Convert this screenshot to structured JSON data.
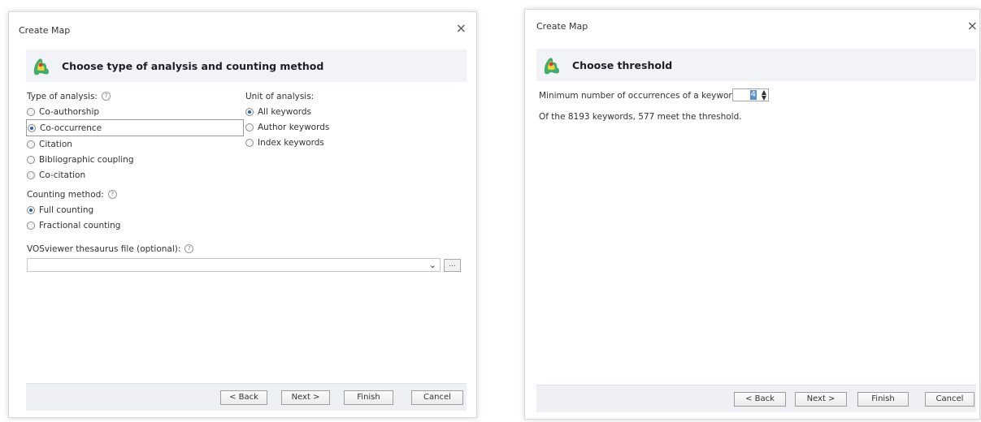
{
  "dialog1": {
    "window_title": "Create Map",
    "close_glyph": "×",
    "header_title": "Choose type of analysis and counting method",
    "type_of_analysis": {
      "label": "Type of analysis:",
      "options": [
        "Co-authorship",
        "Co-occurrence",
        "Citation",
        "Bibliographic coupling",
        "Co-citation"
      ],
      "selected": "Co-occurrence"
    },
    "unit_of_analysis": {
      "label": "Unit of analysis:",
      "options": [
        "All keywords",
        "Author keywords",
        "Index keywords"
      ],
      "selected": "All keywords"
    },
    "counting_method": {
      "label": "Counting method:",
      "options": [
        "Full counting",
        "Fractional counting"
      ],
      "selected": "Full counting"
    },
    "thesaurus": {
      "label": "VOSviewer thesaurus file (optional):",
      "value": "",
      "browse_label": "..."
    },
    "buttons": {
      "back": "< Back",
      "next": "Next >",
      "finish": "Finish",
      "cancel": "Cancel"
    }
  },
  "dialog2": {
    "window_title": "Create Map",
    "close_glyph": "×",
    "header_title": "Choose threshold",
    "threshold": {
      "label": "Minimum number of occurrences of a keyword:",
      "value": "4",
      "result_text": "Of the 8193 keywords, 577 meet the threshold."
    },
    "buttons": {
      "back": "< Back",
      "next": "Next >",
      "finish": "Finish",
      "cancel": "Cancel"
    }
  },
  "icons": {
    "logo": "vosviewer-logo-icon",
    "help": "help-circle-icon",
    "close": "close-icon",
    "dropdown": "chevron-down-icon",
    "spinner": "spinner-arrows-icon"
  },
  "colors": {
    "header_band": "#f2f3f6",
    "footer_band": "#eef0f3",
    "radio_selected": "#2b5fb4",
    "selection_highlight": "#5a8fd8"
  }
}
